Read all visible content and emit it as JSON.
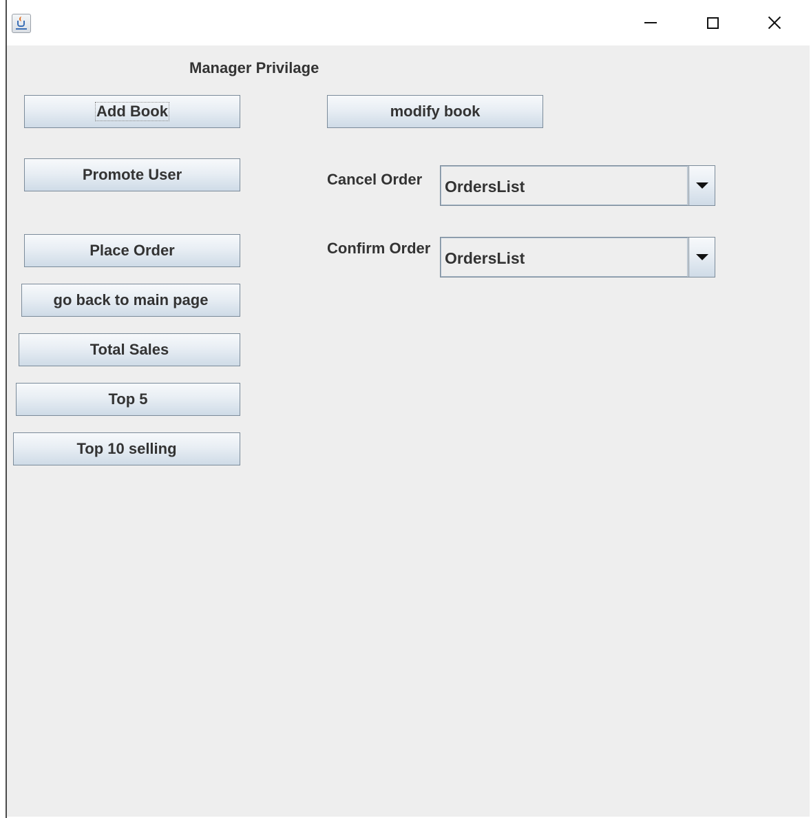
{
  "window": {
    "controls": [
      "minimize-icon",
      "maximize-icon",
      "close-icon"
    ]
  },
  "panel": {
    "heading": "Manager Privilage"
  },
  "buttons": {
    "add_book": "Add Book",
    "modify_book": "modify book",
    "promote_user": "Promote User",
    "place_order": "Place Order",
    "go_back": "go back to main page",
    "total_sales": "Total Sales",
    "top5": "Top 5",
    "top10": "Top 10 selling"
  },
  "orders": {
    "cancel_label": "Cancel Order",
    "cancel_selected": "OrdersList",
    "confirm_label": "Confirm Order",
    "confirm_selected": "OrdersList"
  },
  "colors": {
    "panel_bg": "#eeeeee",
    "button_top": "#f7f9fb",
    "button_bottom": "#cfdbe7",
    "button_border": "#7a8a99",
    "text": "#333333"
  }
}
